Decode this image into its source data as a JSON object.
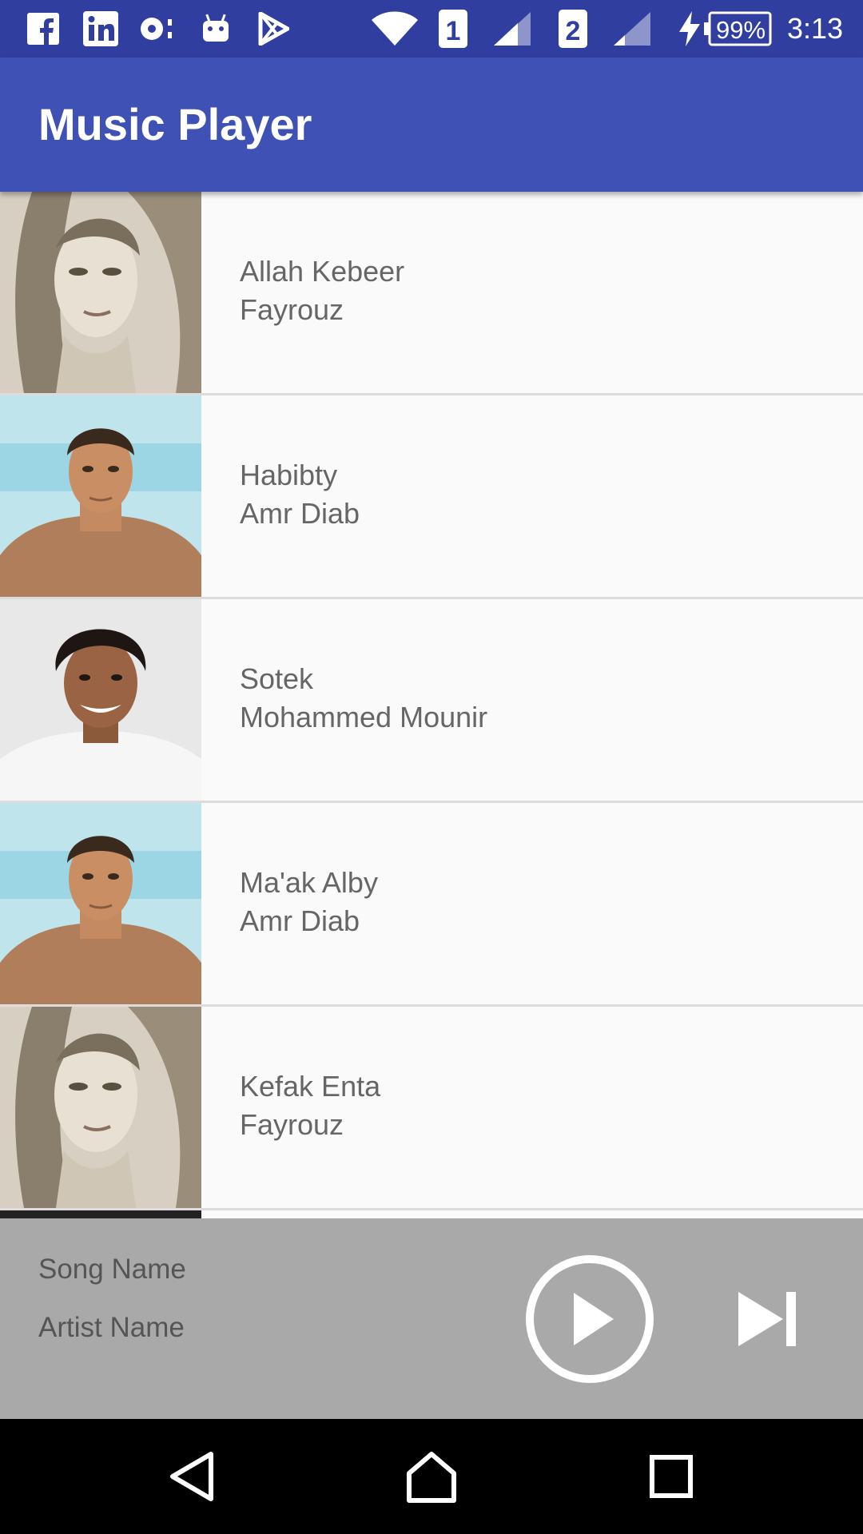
{
  "status_bar": {
    "battery": "99%",
    "time": "3:13",
    "sim1": "1",
    "sim2": "2",
    "icons": [
      "facebook-icon",
      "linkedin-icon",
      "notification-icon",
      "android-icon",
      "play-store-icon",
      "wifi-icon",
      "sim1-icon",
      "signal-icon",
      "sim2-icon",
      "signal-weak-icon",
      "charging-icon",
      "battery-icon"
    ]
  },
  "appbar": {
    "title": "Music Player"
  },
  "songs": [
    {
      "title": "Allah Kebeer",
      "artist": "Fayrouz"
    },
    {
      "title": "Habibty",
      "artist": "Amr Diab"
    },
    {
      "title": "Sotek",
      "artist": "Mohammed Mounir"
    },
    {
      "title": "Ma'ak Alby",
      "artist": "Amr Diab"
    },
    {
      "title": "Kefak Enta",
      "artist": "Fayrouz"
    }
  ],
  "player": {
    "song_name": "Song Name",
    "artist_name": "Artist Name",
    "play_icon": "play-icon",
    "next_icon": "skip-next-icon"
  },
  "navbar": {
    "icons": [
      "back-icon",
      "home-icon",
      "recents-icon"
    ]
  },
  "colors": {
    "primary": "#3f51b5",
    "primary_dark": "#303f9f",
    "player_bg": "#a9a9a9"
  }
}
